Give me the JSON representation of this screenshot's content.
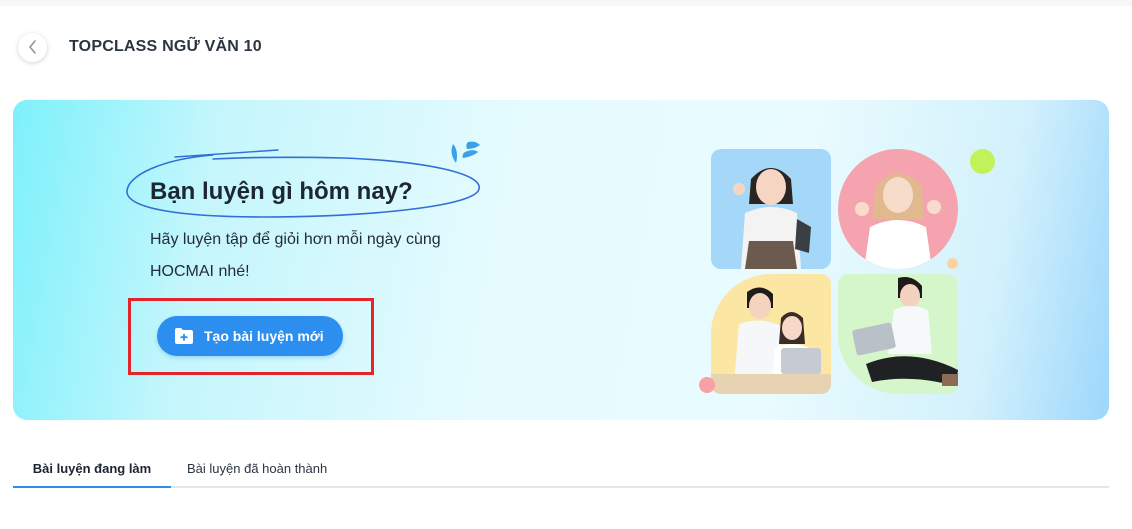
{
  "header": {
    "title": "TOPCLASS NGỮ VĂN 10"
  },
  "banner": {
    "heading": "Bạn luyện gì hôm nay?",
    "subtitle_line1": "Hãy luyện tập để giỏi hơn mỗi ngày cùng",
    "subtitle_line2": "HOCMAI nhé!",
    "create_button_label": "Tạo bài luyện mới",
    "icons": {
      "back": "chevron-left-icon",
      "create": "folder-plus-icon"
    }
  },
  "tabs": [
    {
      "label": "Bài luyện đang làm",
      "active": true
    },
    {
      "label": "Bài luyện đã hoàn thành",
      "active": false
    }
  ],
  "colors": {
    "accent": "#2c8ff0",
    "highlight": "#e3242b",
    "title": "#1d2733"
  }
}
